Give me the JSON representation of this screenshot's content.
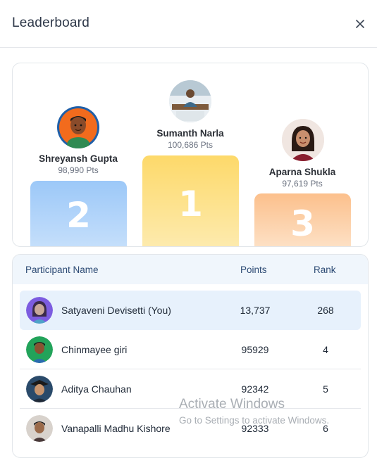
{
  "header": {
    "title": "Leaderboard"
  },
  "podium": {
    "first": {
      "name": "Sumanth Narla",
      "points": "100,686 Pts",
      "rank": "1"
    },
    "second": {
      "name": "Shreyansh Gupta",
      "points": "98,990 Pts",
      "rank": "2"
    },
    "third": {
      "name": "Aparna Shukla",
      "points": "97,619 Pts",
      "rank": "3"
    }
  },
  "table": {
    "headers": {
      "name": "Participant Name",
      "points": "Points",
      "rank": "Rank"
    },
    "rows": [
      {
        "name": "Satyaveni Devisetti (You)",
        "points": "13,737",
        "rank": "268"
      },
      {
        "name": "Chinmayee giri",
        "points": "95929",
        "rank": "4"
      },
      {
        "name": "Aditya Chauhan",
        "points": "92342",
        "rank": "5"
      },
      {
        "name": "Vanapalli Madhu Kishore",
        "points": "92333",
        "rank": "6"
      }
    ]
  },
  "watermark": {
    "line1": "Activate Windows",
    "line2": "Go to Settings to activate Windows."
  },
  "colors": {
    "gold": "#fde68a",
    "silver_blue": "#9cc8f8",
    "bronze_peach": "#fcc08c",
    "you_highlight": "#e7f1fc",
    "header_text": "#2c4a74"
  }
}
